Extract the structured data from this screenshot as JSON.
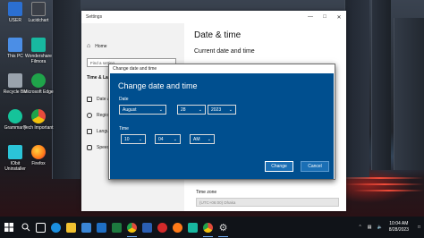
{
  "desktop": {
    "icons": [
      {
        "label": "USER",
        "color": "#2b6fd1"
      },
      {
        "label": "Lucidchart",
        "color": "#3b3f47"
      },
      {
        "label": "This PC",
        "color": "#4b8ee6"
      },
      {
        "label": "Wondershare Filmora",
        "color": "#18b8a0"
      },
      {
        "label": "Recycle Bin",
        "color": "#9aa3ad"
      },
      {
        "label": "Microsoft Edge",
        "color": "#1fa34a"
      },
      {
        "label": "Grammarly",
        "color": "#15c39a"
      },
      {
        "label": "Tech Important",
        "color": "#e84b3c"
      },
      {
        "label": "IObit Uninstaller",
        "color": "#2bc4d8"
      },
      {
        "label": "Firefox",
        "color": "#ff7a18"
      }
    ]
  },
  "settings": {
    "window_title": "Settings",
    "nav": {
      "home": "Home",
      "search_placeholder": "Find a setting",
      "section": "Time & Language",
      "items": [
        {
          "label": "Date & time"
        },
        {
          "label": "Region"
        },
        {
          "label": "Language"
        },
        {
          "label": "Speech"
        }
      ]
    },
    "main": {
      "title": "Date & time",
      "subtitle": "Current date and time",
      "timezone_label": "Time zone",
      "timezone_value": "(UTC+06:00) Dhaka"
    }
  },
  "dialog": {
    "window_title": "Change date and time",
    "heading": "Change date and time",
    "date_label": "Date",
    "month": "August",
    "day": "28",
    "year": "2023",
    "time_label": "Time",
    "hour": "10",
    "minute": "04",
    "ampm": "AM",
    "change_button": "Change",
    "cancel_button": "Cancel"
  },
  "taskbar": {
    "apps": [
      {
        "name": "task-view",
        "color": "#ffffff"
      },
      {
        "name": "edge",
        "color": "#1b8fe0"
      },
      {
        "name": "file-explorer",
        "color": "#f2c230"
      },
      {
        "name": "store",
        "color": "#3a86d6"
      },
      {
        "name": "mail",
        "color": "#1f6fc4"
      },
      {
        "name": "excel",
        "color": "#1d7a3f"
      },
      {
        "name": "chrome",
        "color": "#e24b3b"
      },
      {
        "name": "word",
        "color": "#2b5fb3"
      },
      {
        "name": "opera",
        "color": "#d42a2a"
      },
      {
        "name": "firefox",
        "color": "#ff7a18"
      },
      {
        "name": "filmora",
        "color": "#18b8a0"
      },
      {
        "name": "chrome-2",
        "color": "#e24b3b"
      },
      {
        "name": "settings",
        "color": "#d0d0d0"
      }
    ],
    "time": "10:04 AM",
    "date": "8/28/2023"
  }
}
